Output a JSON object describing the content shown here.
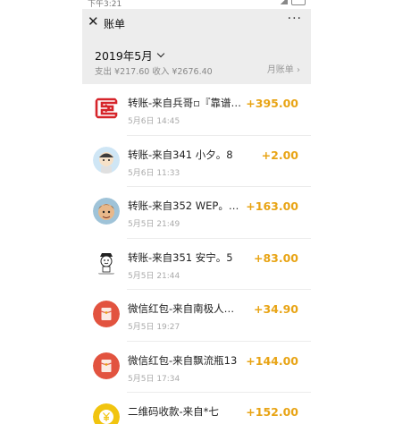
{
  "status": {
    "time": "下午3:21"
  },
  "header": {
    "title": "账单",
    "more": "···"
  },
  "summary": {
    "month": "2019年5月",
    "totals": "支出 ¥217.60 收入 ¥2676.40",
    "monthly_link": "月账单 ›"
  },
  "colors": {
    "amount": "#e8a415",
    "header_bg": "#ededed",
    "red_packet": "#e2533f"
  },
  "transactions": [
    {
      "title": "转账-来自兵哥▫『靠谱才…",
      "date": "5月6日 14:45",
      "amount": "+395.00",
      "avatar": "logo-red-square"
    },
    {
      "title": "转账-来自341 小夕。8",
      "date": "5月6日 11:33",
      "amount": "+2.00",
      "avatar": "cartoon-boy"
    },
    {
      "title": "转账-来自352 WEP。5降…",
      "date": "5月5日 21:49",
      "amount": "+163.00",
      "avatar": "cartoon-face"
    },
    {
      "title": "转账-来自351 安宁。5",
      "date": "5月5日 21:44",
      "amount": "+83.00",
      "avatar": "doodle-boy"
    },
    {
      "title": "微信红包-来自南极人老…",
      "date": "5月5日 19:27",
      "amount": "+34.90",
      "avatar": "red-packet-icon"
    },
    {
      "title": "微信红包-来自飘流瓶13",
      "date": "5月5日 17:34",
      "amount": "+144.00",
      "avatar": "red-packet-icon"
    },
    {
      "title": "二维码收款-来自*七",
      "date": "",
      "amount": "+152.00",
      "avatar": "yuan-coin-icon"
    }
  ]
}
